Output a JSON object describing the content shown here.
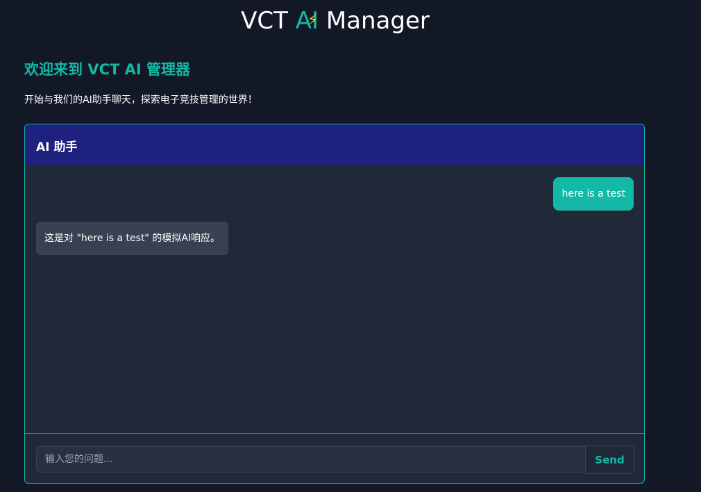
{
  "brand": {
    "prefix": "VCT ",
    "ai": "AI",
    "suffix": " Manager",
    "bolt_icon": "lightning-icon"
  },
  "welcome": {
    "title": "欢迎来到 VCT AI 管理器",
    "subtitle": "开始与我们的AI助手聊天，探索电子竞技管理的世界！"
  },
  "chat": {
    "header": "AI 助手",
    "messages": [
      {
        "role": "user",
        "text": "here is a test"
      },
      {
        "role": "assistant",
        "text": "这是对 \"here is a test\" 的模拟AI响应。"
      }
    ],
    "input_placeholder": "输入您的问题...",
    "input_value": "",
    "send_label": "Send"
  },
  "colors": {
    "accent": "#14b8a6",
    "header_bg": "#1e2180",
    "page_bg": "#121826",
    "panel_bg": "#1f2937"
  }
}
